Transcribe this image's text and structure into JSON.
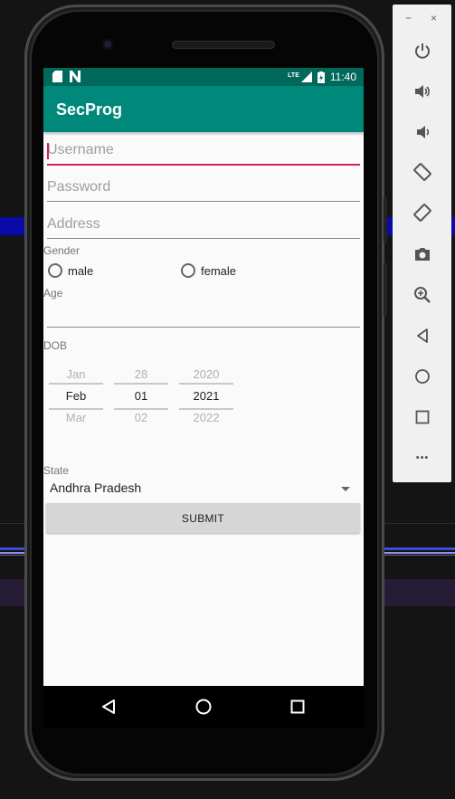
{
  "statusbar": {
    "network": "LTE",
    "time": "11:40"
  },
  "app": {
    "title": "SecProg"
  },
  "form": {
    "username_placeholder": "Username",
    "password_placeholder": "Password",
    "address_placeholder": "Address",
    "gender_label": "Gender",
    "gender_options": [
      "male",
      "female"
    ],
    "age_label": "Age",
    "dob_label": "DOB",
    "dob_picker": {
      "month": {
        "prev": "Jan",
        "selected": "Feb",
        "next": "Mar"
      },
      "day": {
        "prev": "28",
        "selected": "01",
        "next": "02"
      },
      "year": {
        "prev": "2020",
        "selected": "2021",
        "next": "2022"
      }
    },
    "state_label": "State",
    "state_selected": "Andhra Pradesh",
    "submit_label": "SUBMIT"
  },
  "colors": {
    "statusbar": "#00695c",
    "appbar": "#00897b",
    "accent": "#d81b60"
  },
  "emulator": {
    "window_controls": [
      "−",
      "×"
    ],
    "tools": [
      "power-icon",
      "volume-up-icon",
      "volume-down-icon",
      "rotate-left-icon",
      "rotate-right-icon",
      "camera-icon",
      "zoom-icon",
      "back-icon",
      "home-icon",
      "overview-icon",
      "more-icon"
    ],
    "more_label": "•••"
  }
}
